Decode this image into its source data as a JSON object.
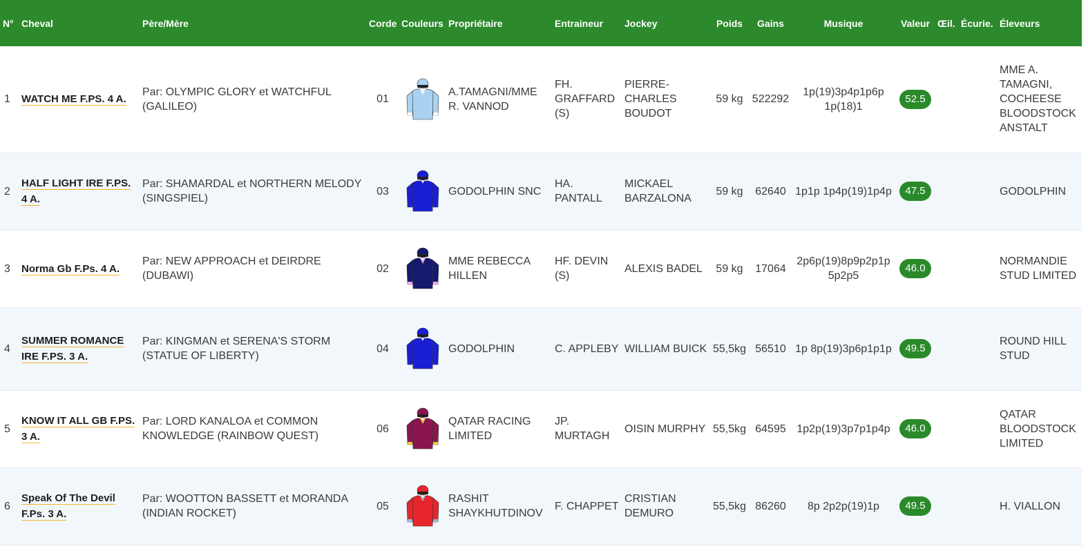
{
  "headers": {
    "num": "N°",
    "cheval": "Cheval",
    "pere_mere": "Père/Mère",
    "corde": "Corde",
    "couleurs": "Couleurs",
    "proprietaire": "Propriétaire",
    "entraineur": "Entraineur",
    "jockey": "Jockey",
    "poids": "Poids",
    "gains": "Gains",
    "musique": "Musique",
    "valeur": "Valeur",
    "oeil": "Œil.",
    "ecurie": "Écurie.",
    "eleveurs": "Éleveurs"
  },
  "runners": [
    {
      "num": "1",
      "cheval": "WATCH ME F.PS. 4 A.",
      "pere_mere": "Par: OLYMPIC GLORY et WATCHFUL (GALILEO)",
      "corde": "01",
      "proprietaire": "A.TAMAGNI/MME R. VANNOD",
      "entraineur": "FH. GRAFFARD (S)",
      "jockey": "PIERRE-CHARLES BOUDOT",
      "poids": "59 kg",
      "gains": "522292",
      "musique": "1p(19)3p4p1p6p 1p(18)1",
      "valeur": "52.5",
      "oeil": "",
      "ecurie": "",
      "eleveurs": "MME A. TAMAGNI, COCHEESE BLOODSTOCK ANSTALT",
      "colors": {
        "body": "#a9d2f0",
        "cap": "#a9d2f0",
        "sleeve": "#a9d2f0",
        "accent": "#ffffff"
      }
    },
    {
      "num": "2",
      "cheval": "HALF LIGHT IRE F.PS. 4 A.",
      "pere_mere": "Par: SHAMARDAL et NORTHERN MELODY (SINGSPIEL)",
      "corde": "03",
      "proprietaire": "GODOLPHIN SNC",
      "entraineur": "HA. PANTALL",
      "jockey": "MICKAEL BARZALONA",
      "poids": "59 kg",
      "gains": "62640",
      "musique": "1p1p 1p4p(19)1p4p",
      "valeur": "47.5",
      "oeil": "",
      "ecurie": "",
      "eleveurs": "GODOLPHIN",
      "colors": {
        "body": "#1a1fd6",
        "cap": "#1a1fd6",
        "sleeve": "#1a1fd6",
        "accent": "#1a1fd6"
      }
    },
    {
      "num": "3",
      "cheval": "Norma Gb F.Ps. 4 A.",
      "pere_mere": "Par: NEW APPROACH et DEIRDRE (DUBAWI)",
      "corde": "02",
      "proprietaire": "MME REBECCA HILLEN",
      "entraineur": "HF. DEVIN (S)",
      "jockey": "ALEXIS BADEL",
      "poids": "59 kg",
      "gains": "17064",
      "musique": "2p6p(19)8p9p2p1p 5p2p5",
      "valeur": "46.0",
      "oeil": "",
      "ecurie": "",
      "eleveurs": "NORMANDIE STUD LIMITED",
      "colors": {
        "body": "#141a6e",
        "cap": "#141a6e",
        "sleeve": "#141a6e",
        "accent": "#f3a6e6"
      }
    },
    {
      "num": "4",
      "cheval": "SUMMER ROMANCE IRE F.PS. 3 A.",
      "pere_mere": "Par: KINGMAN et SERENA'S STORM (STATUE OF LIBERTY)",
      "corde": "04",
      "proprietaire": "GODOLPHIN",
      "entraineur": "C. APPLEBY",
      "jockey": "WILLIAM BUICK",
      "poids": "55,5kg",
      "gains": "56510",
      "musique": "1p 8p(19)3p6p1p1p",
      "valeur": "49.5",
      "oeil": "",
      "ecurie": "",
      "eleveurs": "ROUND HILL STUD",
      "colors": {
        "body": "#1a1fd6",
        "cap": "#1a1fd6",
        "sleeve": "#1a1fd6",
        "accent": "#1a1fd6"
      }
    },
    {
      "num": "5",
      "cheval": "KNOW IT ALL GB F.PS. 3 A.",
      "pere_mere": "Par: LORD KANALOA et COMMON KNOWLEDGE (RAINBOW QUEST)",
      "corde": "06",
      "proprietaire": "QATAR RACING LIMITED",
      "entraineur": "JP. MURTAGH",
      "jockey": "OISIN MURPHY",
      "poids": "55,5kg",
      "gains": "64595",
      "musique": "1p2p(19)3p7p1p4p",
      "valeur": "46.0",
      "oeil": "",
      "ecurie": "",
      "eleveurs": "QATAR BLOODSTOCK LIMITED",
      "colors": {
        "body": "#8a1650",
        "cap": "#8a1650",
        "sleeve": "#8a1650",
        "accent": "#f2c230"
      }
    },
    {
      "num": "6",
      "cheval": "Speak Of The Devil F.Ps. 3 A.",
      "pere_mere": "Par: WOOTTON BASSETT et MORANDA (INDIAN ROCKET)",
      "corde": "05",
      "proprietaire": "RASHIT SHAYKHUTDINOV",
      "entraineur": "F. CHAPPET",
      "jockey": "CRISTIAN DEMURO",
      "poids": "55,5kg",
      "gains": "86260",
      "musique": "8p 2p2p(19)1p",
      "valeur": "49.5",
      "oeil": "",
      "ecurie": "",
      "eleveurs": "H. VIALLON",
      "colors": {
        "body": "#e8252b",
        "cap": "#e8252b",
        "sleeve": "#e8252b",
        "accent": "#9fb8d8"
      }
    }
  ]
}
